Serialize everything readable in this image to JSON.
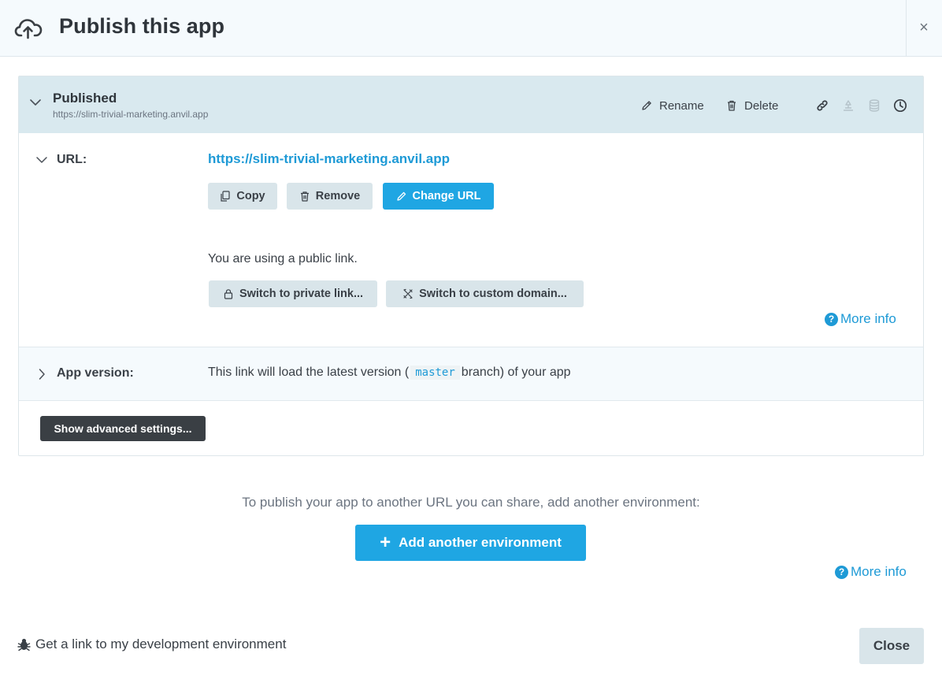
{
  "header": {
    "title": "Publish this app",
    "close_symbol": "×",
    "icon": "cloud-upload-icon"
  },
  "environment": {
    "name": "Published",
    "url_subtitle": "https://slim-trivial-marketing.anvil.app",
    "actions": {
      "rename_label": "Rename",
      "delete_label": "Delete"
    },
    "header_icons": [
      "link-icon",
      "pin-icon",
      "database-icon",
      "history-icon"
    ],
    "url_row": {
      "label": "URL:",
      "url": "https://slim-trivial-marketing.anvil.app",
      "copy_label": "Copy",
      "remove_label": "Remove",
      "change_url_label": "Change URL",
      "public_link_text": "You are using a public link.",
      "private_link_label": "Switch to private link...",
      "custom_domain_label": "Switch to custom domain...",
      "more_info_label": "More info"
    },
    "version_row": {
      "label": "App version:",
      "text_before": "This link will load the latest version (",
      "branch": "master",
      "text_after": "branch) of your app"
    },
    "advanced_settings_label": "Show advanced settings..."
  },
  "add_environment": {
    "hint": "To publish your app to another URL you can share, add another environment:",
    "button_label": "Add another environment",
    "more_info_label": "More info"
  },
  "footer": {
    "dev_link_label": "Get a link to my development environment",
    "close_label": "Close"
  },
  "colors": {
    "accent": "#1fa6e3",
    "link": "#1e9ad6",
    "header_bg": "#f5fafd",
    "card_head_bg": "#d9e9ef",
    "grey_button": "#d9e5ea",
    "dark_button": "#3a3f44"
  }
}
